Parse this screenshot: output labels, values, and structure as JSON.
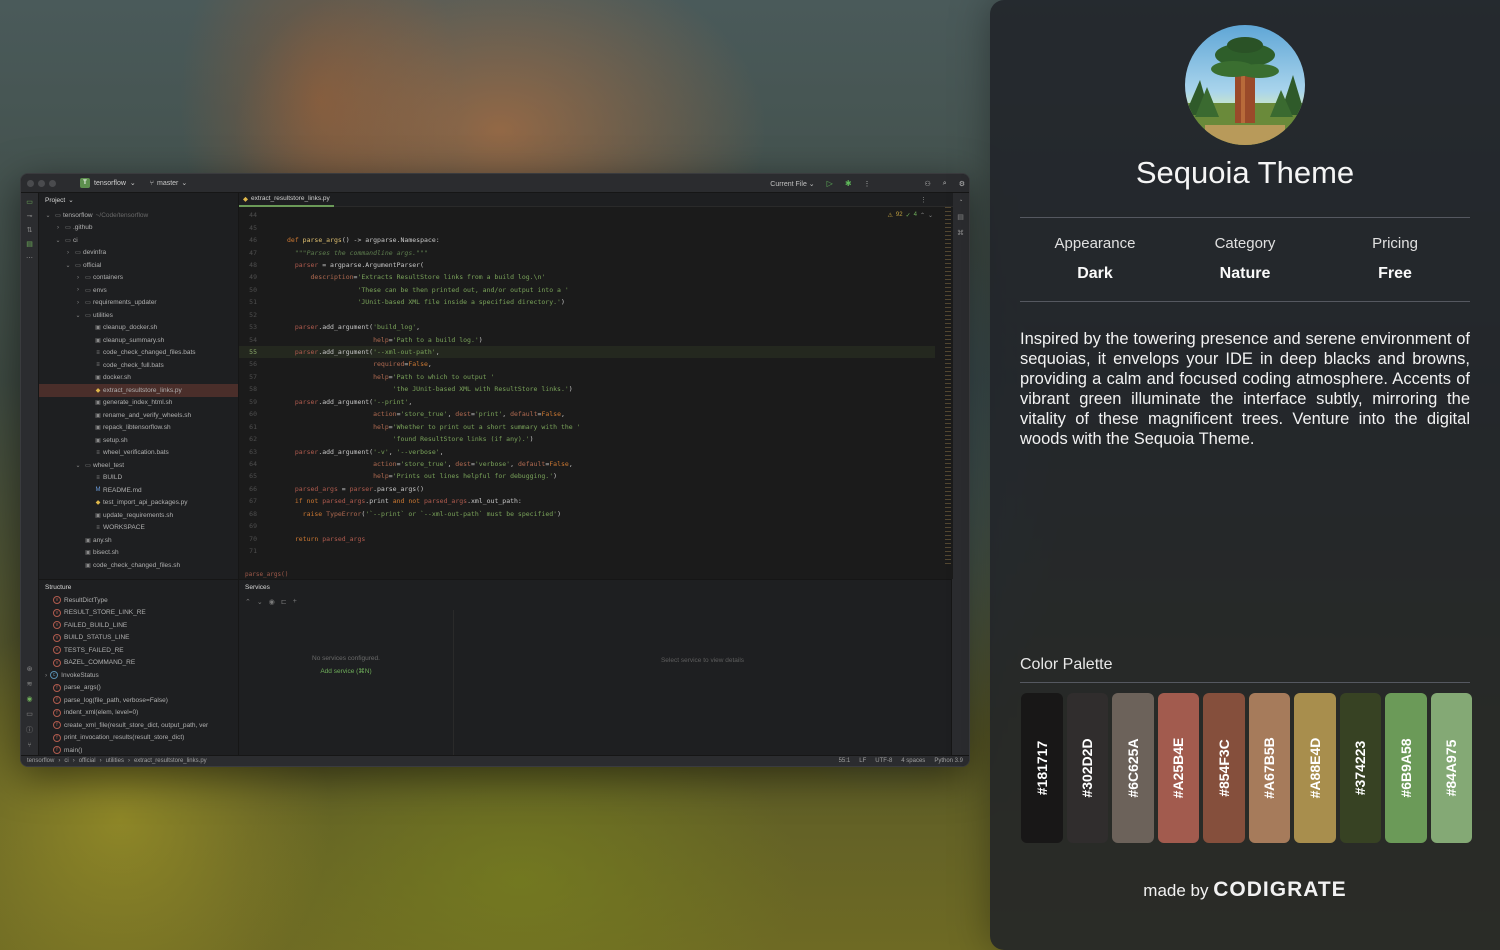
{
  "ide": {
    "project_name": "tensorflow",
    "project_initial": "T",
    "branch": "master",
    "run_config": "Current File",
    "project_panel_title": "Project",
    "tree": [
      {
        "label": "tensorflow",
        "path": "~/Code/tensorflow",
        "depth": 0,
        "type": "folder"
      },
      {
        "label": ".github",
        "depth": 1,
        "type": "folder"
      },
      {
        "label": "ci",
        "depth": 1,
        "type": "folder"
      },
      {
        "label": "devinfra",
        "depth": 2,
        "type": "folder"
      },
      {
        "label": "official",
        "depth": 2,
        "type": "folder"
      },
      {
        "label": "containers",
        "depth": 3,
        "type": "folder"
      },
      {
        "label": "envs",
        "depth": 3,
        "type": "folder"
      },
      {
        "label": "requirements_updater",
        "depth": 3,
        "type": "folder"
      },
      {
        "label": "utilities",
        "depth": 3,
        "type": "folder"
      },
      {
        "label": "cleanup_docker.sh",
        "depth": 4,
        "type": "sh"
      },
      {
        "label": "cleanup_summary.sh",
        "depth": 4,
        "type": "sh"
      },
      {
        "label": "code_check_changed_files.bats",
        "depth": 4,
        "type": "txt"
      },
      {
        "label": "code_check_full.bats",
        "depth": 4,
        "type": "txt"
      },
      {
        "label": "docker.sh",
        "depth": 4,
        "type": "sh"
      },
      {
        "label": "extract_resultstore_links.py",
        "depth": 4,
        "type": "py",
        "selected": true
      },
      {
        "label": "generate_index_html.sh",
        "depth": 4,
        "type": "sh"
      },
      {
        "label": "rename_and_verify_wheels.sh",
        "depth": 4,
        "type": "sh"
      },
      {
        "label": "repack_libtensorflow.sh",
        "depth": 4,
        "type": "sh"
      },
      {
        "label": "setup.sh",
        "depth": 4,
        "type": "sh"
      },
      {
        "label": "wheel_verification.bats",
        "depth": 4,
        "type": "txt"
      },
      {
        "label": "wheel_test",
        "depth": 3,
        "type": "folder"
      },
      {
        "label": "BUILD",
        "depth": 4,
        "type": "txt"
      },
      {
        "label": "README.md",
        "depth": 4,
        "type": "md"
      },
      {
        "label": "test_import_api_packages.py",
        "depth": 4,
        "type": "py"
      },
      {
        "label": "update_requirements.sh",
        "depth": 4,
        "type": "sh"
      },
      {
        "label": "WORKSPACE",
        "depth": 4,
        "type": "txt"
      },
      {
        "label": "any.sh",
        "depth": 3,
        "type": "sh"
      },
      {
        "label": "bisect.sh",
        "depth": 3,
        "type": "sh"
      },
      {
        "label": "code_check_changed_files.sh",
        "depth": 3,
        "type": "sh"
      }
    ],
    "editor_tab": "extract_resultstore_links.py",
    "inspections": {
      "warnings": "92",
      "ok": "4"
    },
    "code_lines": [
      {
        "n": "44",
        "html": ""
      },
      {
        "n": "45",
        "html": ""
      },
      {
        "n": "46",
        "html": "<span class='k'>def</span> <span class='f'>parse_args</span>() -> argparse.Namespace:"
      },
      {
        "n": "47",
        "html": "  <span class='d'>\"\"\"Parses the commandline args.\"\"\"</span>"
      },
      {
        "n": "48",
        "html": "  <span class='v'>parser</span> = argparse.ArgumentParser("
      },
      {
        "n": "49",
        "html": "      <span class='p'>description</span>=<span class='s'>'Extracts ResultStore links from a build log.\\n'</span>"
      },
      {
        "n": "50",
        "html": "                  <span class='s'>'These can be then printed out, and/or output into a '</span>"
      },
      {
        "n": "51",
        "html": "                  <span class='s'>'JUnit-based XML file inside a specified directory.'</span>)"
      },
      {
        "n": "52",
        "html": ""
      },
      {
        "n": "53",
        "html": "  <span class='v'>parser</span>.add_argument(<span class='s'>'build_log'</span>,"
      },
      {
        "n": "54",
        "html": "                      <span class='p'>help</span>=<span class='s'>'Path to a build log.'</span>)"
      },
      {
        "n": "55",
        "html": "  <span class='v'>parser</span>.add_argument(<span class='s'>'--xml-out-path'</span>,",
        "cur": true
      },
      {
        "n": "56",
        "html": "                      <span class='p'>required</span>=<span class='k'>False</span>,"
      },
      {
        "n": "57",
        "html": "                      <span class='p'>help</span>=<span class='s'>'Path to which to output '</span>"
      },
      {
        "n": "58",
        "html": "                           <span class='s'>'the JUnit-based XML with ResultStore links.'</span>)"
      },
      {
        "n": "59",
        "html": "  <span class='v'>parser</span>.add_argument(<span class='s'>'--print'</span>,"
      },
      {
        "n": "60",
        "html": "                      <span class='p'>action</span>=<span class='s'>'store_true'</span>, <span class='p'>dest</span>=<span class='s'>'print'</span>, <span class='p'>default</span>=<span class='k'>False</span>,"
      },
      {
        "n": "61",
        "html": "                      <span class='p'>help</span>=<span class='s'>'Whether to print out a short summary with the '</span>"
      },
      {
        "n": "62",
        "html": "                           <span class='s'>'found ResultStore links (if any).'</span>)"
      },
      {
        "n": "63",
        "html": "  <span class='v'>parser</span>.add_argument(<span class='s'>'-v'</span>, <span class='s'>'--verbose'</span>,"
      },
      {
        "n": "64",
        "html": "                      <span class='p'>action</span>=<span class='s'>'store_true'</span>, <span class='p'>dest</span>=<span class='s'>'verbose'</span>, <span class='p'>default</span>=<span class='k'>False</span>,"
      },
      {
        "n": "65",
        "html": "                      <span class='p'>help</span>=<span class='s'>'Prints out lines helpful for debugging.'</span>)"
      },
      {
        "n": "66",
        "html": "  <span class='v'>parsed_args</span> = <span class='v'>parser</span>.parse_args()"
      },
      {
        "n": "67",
        "html": "  <span class='k'>if not</span> <span class='v'>parsed_args</span>.print <span class='k'>and not</span> <span class='v'>parsed_args</span>.xml_out_path:"
      },
      {
        "n": "68",
        "html": "    <span class='k'>raise</span> <span class='nm'>TypeError</span>(<span class='s'>'`--print` or `--xml-out-path` must be specified'</span>)"
      },
      {
        "n": "69",
        "html": ""
      },
      {
        "n": "70",
        "html": "  <span class='k'>return</span> <span class='v'>parsed_args</span>"
      },
      {
        "n": "71",
        "html": ""
      }
    ],
    "editor_breadcrumb": "parse_args()",
    "structure_title": "Structure",
    "structure_items": [
      {
        "label": "ResultDictType",
        "kind": "v"
      },
      {
        "label": "RESULT_STORE_LINK_RE",
        "kind": "v"
      },
      {
        "label": "FAILED_BUILD_LINE",
        "kind": "v"
      },
      {
        "label": "BUILD_STATUS_LINE",
        "kind": "v"
      },
      {
        "label": "TESTS_FAILED_RE",
        "kind": "v"
      },
      {
        "label": "BAZEL_COMMAND_RE",
        "kind": "v"
      },
      {
        "label": "InvokeStatus",
        "kind": "c"
      },
      {
        "label": "parse_args()",
        "kind": "f"
      },
      {
        "label": "parse_log(file_path, verbose=False)",
        "kind": "f"
      },
      {
        "label": "indent_xml(elem, level=0)",
        "kind": "f"
      },
      {
        "label": "create_xml_file(result_store_dict, output_path, ver",
        "kind": "f"
      },
      {
        "label": "print_invocation_results(result_store_dict)",
        "kind": "f"
      },
      {
        "label": "main()",
        "kind": "f"
      }
    ],
    "services_title": "Services",
    "services_empty": "No services configured.",
    "services_add": "Add service (⌘N)",
    "services_select": "Select service to view details",
    "status_path": [
      "tensorflow",
      "ci",
      "official",
      "utilities",
      "extract_resultstore_links.py"
    ],
    "status_right": [
      "55:1",
      "LF",
      "UTF-8",
      "4 spaces",
      "Python 3.9"
    ]
  },
  "card": {
    "title": "Sequoia Theme",
    "meta": [
      {
        "key": "Appearance",
        "value": "Dark"
      },
      {
        "key": "Category",
        "value": "Nature"
      },
      {
        "key": "Pricing",
        "value": "Free"
      }
    ],
    "description": "Inspired by the towering presence and serene environment of sequoias, it envelops your IDE in deep blacks and browns, providing a calm and focused coding atmosphere. Accents of vibrant green illuminate the interface subtly, mirroring the vitality of these magnificent trees. Venture into the digital woods with the Sequoia Theme.",
    "palette_label": "Color Palette",
    "palette": [
      "#181717",
      "#302D2D",
      "#6C625A",
      "#A25B4E",
      "#854F3C",
      "#A67B5B",
      "#A88E4D",
      "#374223",
      "#6B9A58",
      "#84A975"
    ],
    "made_by_prefix": "made by",
    "made_by_brand": "CODIGRATE"
  }
}
